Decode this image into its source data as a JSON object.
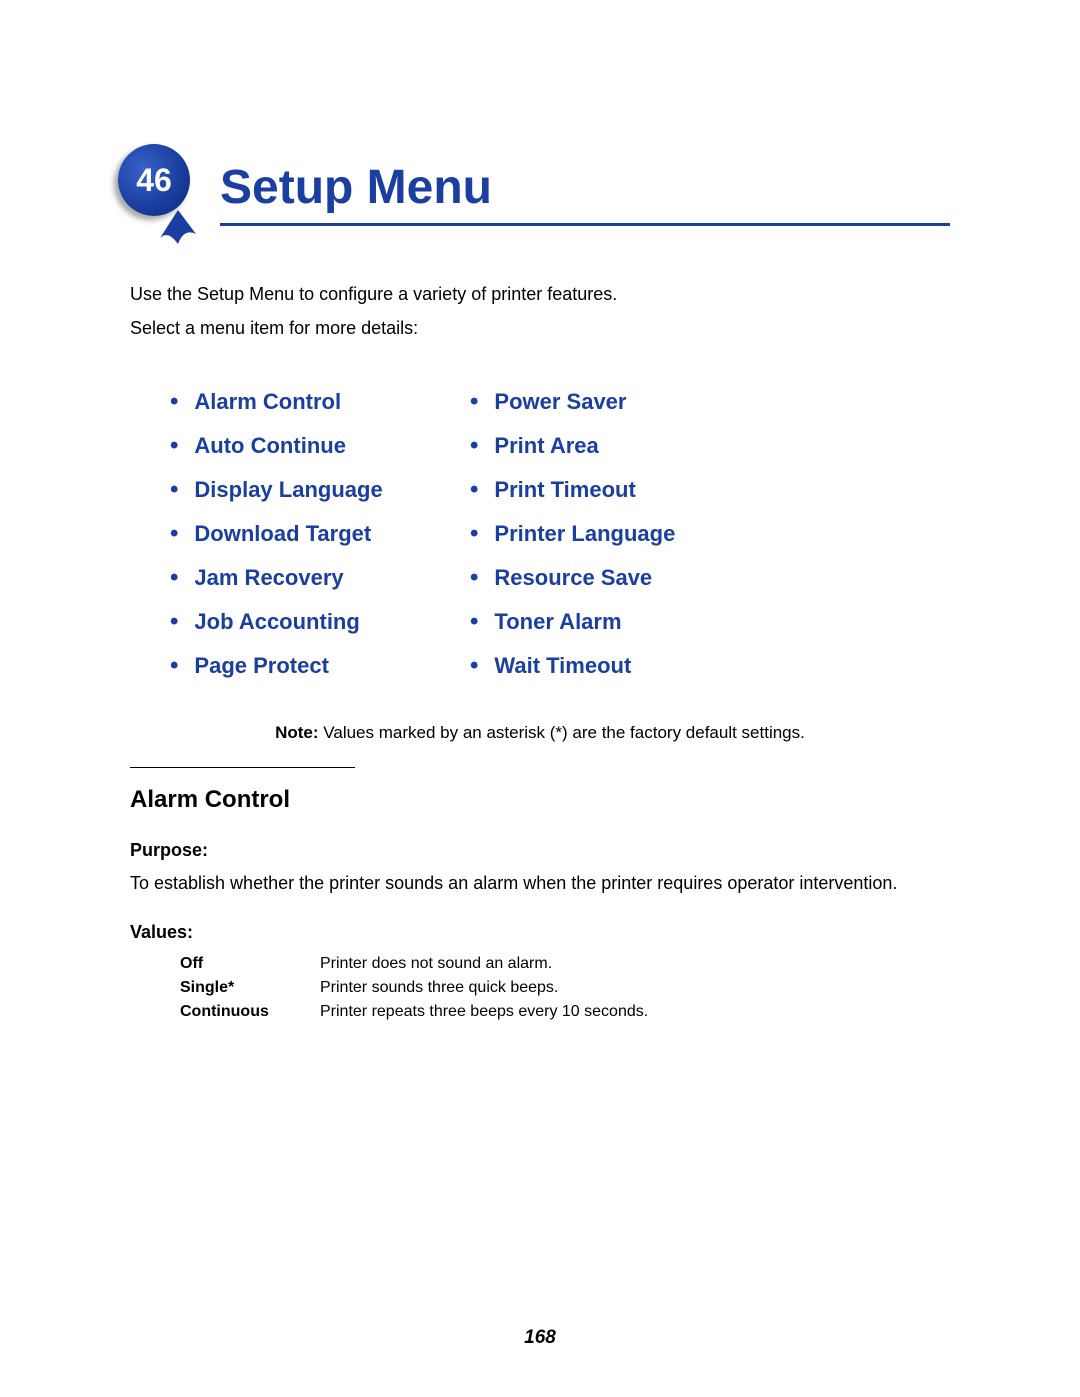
{
  "chapter": {
    "number": "46",
    "title": "Setup Menu"
  },
  "intro": {
    "line1": "Use the Setup Menu to configure a variety of printer features.",
    "line2": "Select a menu item for more details:"
  },
  "menu": {
    "left": [
      "Alarm Control",
      "Auto Continue",
      "Display Language",
      "Download Target",
      "Jam Recovery",
      "Job Accounting",
      "Page Protect"
    ],
    "right": [
      "Power Saver",
      "Print Area",
      "Print Timeout",
      "Printer Language",
      "Resource Save",
      "Toner Alarm",
      "Wait Timeout"
    ]
  },
  "note": {
    "label": "Note:",
    "text": " Values marked by an asterisk (*) are the factory default settings."
  },
  "section": {
    "heading": "Alarm Control",
    "purpose_label": "Purpose:",
    "purpose_text": "To establish whether the printer sounds an alarm when the printer requires operator intervention.",
    "values_label": "Values:",
    "values": [
      {
        "name": "Off",
        "desc": "Printer does not sound an alarm."
      },
      {
        "name": "Single*",
        "desc": "Printer sounds three quick beeps."
      },
      {
        "name": "Continuous",
        "desc": "Printer repeats three beeps every 10 seconds."
      }
    ]
  },
  "page_number": "168"
}
